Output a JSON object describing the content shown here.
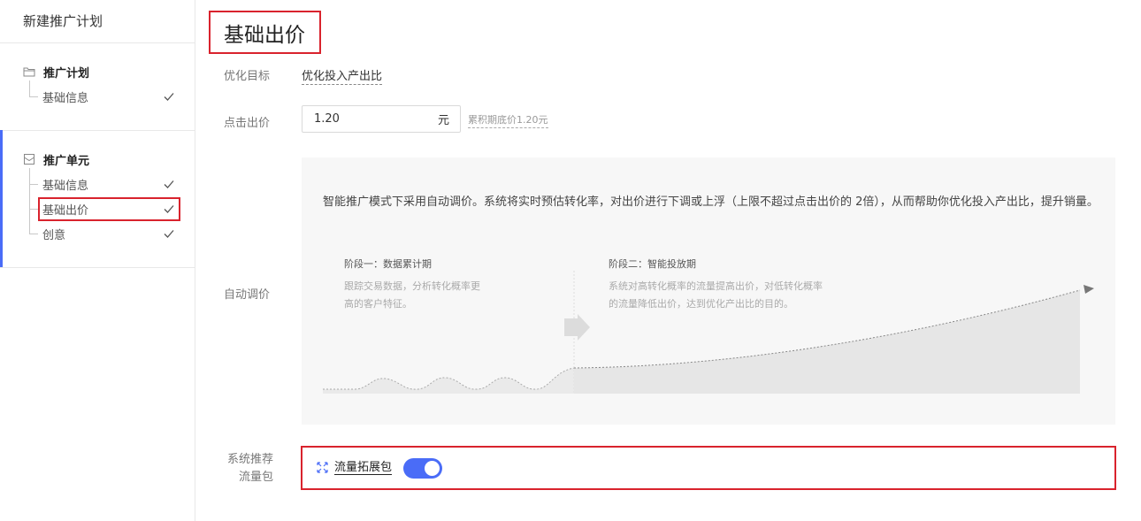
{
  "sidebar": {
    "title": "新建推广计划",
    "groups": [
      {
        "label": "推广计划",
        "items": [
          {
            "label": "基础信息",
            "done": true
          }
        ]
      },
      {
        "label": "推广单元",
        "items": [
          {
            "label": "基础信息",
            "done": true
          },
          {
            "label": "基础出价",
            "done": true,
            "active": true
          },
          {
            "label": "创意",
            "done": true
          }
        ]
      }
    ]
  },
  "main": {
    "title": "基础出价",
    "optimize_goal": {
      "label": "优化目标",
      "value": "优化投入产出比"
    },
    "click_bid": {
      "label": "点击出价",
      "value": "1.20",
      "unit": "元",
      "hint": "累积期底价1.20元"
    },
    "auto_bid": {
      "label": "自动调价",
      "description": "智能推广模式下采用自动调价。系统将实时预估转化率，对出价进行下调或上浮（上限不超过点击出价的 2倍），从而帮助你优化投入产出比，提升销量。",
      "stage1": {
        "title": "阶段一：数据累计期",
        "desc_line1": "跟踪交易数据，分析转化概率更",
        "desc_line2": "高的客户特征。"
      },
      "stage2": {
        "title": "阶段二：智能投放期",
        "desc_line1": "系统对高转化概率的流量提高出价，对低转化概率",
        "desc_line2": "的流量降低出价，达到优化产出比的目的。"
      }
    },
    "traffic_pack": {
      "label_line1": "系统推荐",
      "label_line2": "流量包",
      "name": "流量拓展包",
      "enabled": true
    }
  },
  "colors": {
    "accent": "#4a6cf7",
    "highlight": "#d9232d"
  }
}
